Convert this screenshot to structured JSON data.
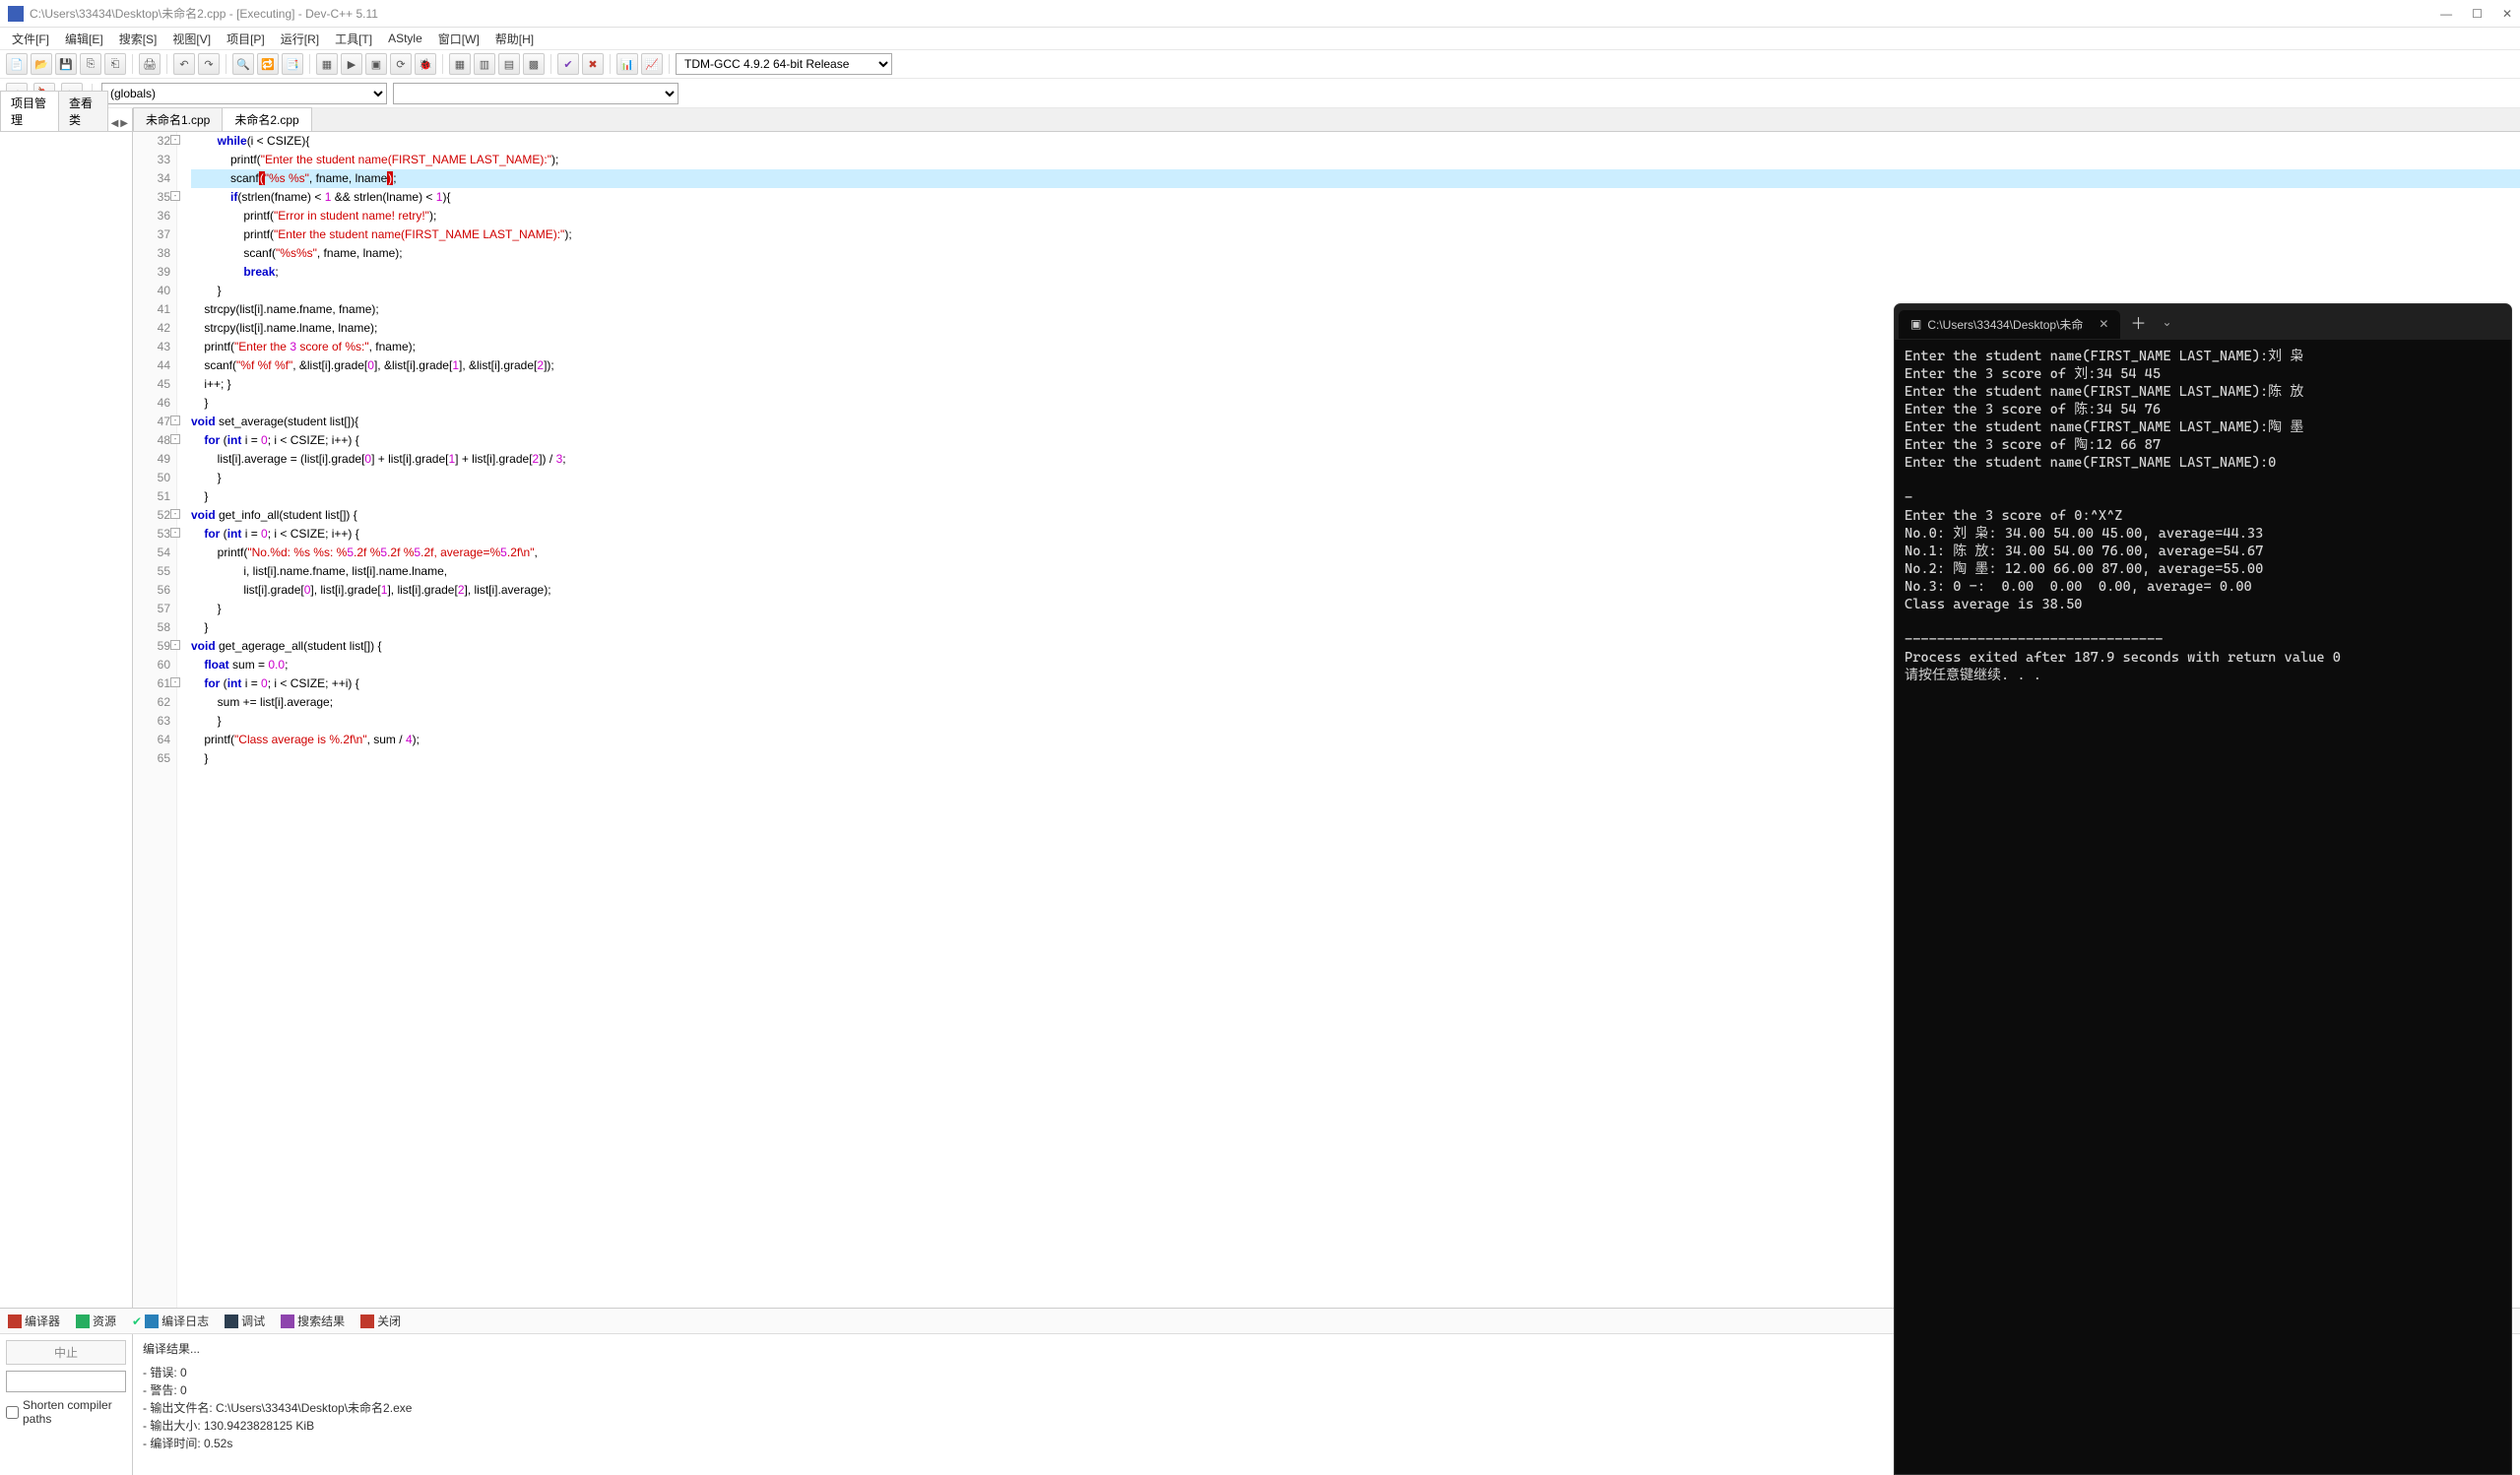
{
  "title": "C:\\Users\\33434\\Desktop\\未命名2.cpp - [Executing] - Dev-C++ 5.11",
  "menu": [
    "文件[F]",
    "编辑[E]",
    "搜索[S]",
    "视图[V]",
    "项目[P]",
    "运行[R]",
    "工具[T]",
    "AStyle",
    "窗口[W]",
    "帮助[H]"
  ],
  "compiler_combo": "TDM-GCC 4.9.2 64-bit Release",
  "globals": "(globals)",
  "left_tabs": [
    "项目管理",
    "查看类"
  ],
  "file_tabs": [
    "未命名1.cpp",
    "未命名2.cpp"
  ],
  "active_file_tab": 1,
  "code_start_line": 32,
  "highlight_line": 34,
  "fold_lines": [
    32,
    35,
    47,
    48,
    52,
    53,
    59,
    61
  ],
  "code_lines": [
    "        while(i < CSIZE){",
    "            printf(\"Enter the student name(FIRST_NAME LAST_NAME):\");",
    "            scanf(\"%s %s\", fname, lname);",
    "            if(strlen(fname) < 1 && strlen(lname) < 1){",
    "                printf(\"Error in student name! retry!\");",
    "                printf(\"Enter the student name(FIRST_NAME LAST_NAME):\");",
    "                scanf(\"%s%s\", fname, lname);",
    "                break;",
    "        }",
    "    strcpy(list[i].name.fname, fname);",
    "    strcpy(list[i].name.lname, lname);",
    "    printf(\"Enter the 3 score of %s:\", fname);",
    "    scanf(\"%f %f %f\", &list[i].grade[0], &list[i].grade[1], &list[i].grade[2]);",
    "    i++; }",
    "    }",
    "void set_average(student list[]){",
    "    for (int i = 0; i < CSIZE; i++) {",
    "        list[i].average = (list[i].grade[0] + list[i].grade[1] + list[i].grade[2]) / 3;",
    "        }",
    "    }",
    "void get_info_all(student list[]) {",
    "    for (int i = 0; i < CSIZE; i++) {",
    "        printf(\"No.%d: %s %s: %5.2f %5.2f %5.2f, average=%5.2f\\n\",",
    "                i, list[i].name.fname, list[i].name.lname,",
    "                list[i].grade[0], list[i].grade[1], list[i].grade[2], list[i].average);",
    "        }",
    "    }",
    "void get_agerage_all(student list[]) {",
    "    float sum = 0.0;",
    "    for (int i = 0; i < CSIZE; ++i) {",
    "        sum += list[i].average;",
    "        }",
    "    printf(\"Class average is %.2f\\n\", sum / 4);",
    "    }"
  ],
  "bottom_tabs": [
    {
      "icon": "#c0392b",
      "label": "编译器"
    },
    {
      "icon": "#27ae60",
      "label": "资源"
    },
    {
      "icon": "#2980b9",
      "label": "编译日志"
    },
    {
      "icon": "#2c3e50",
      "label": "调试"
    },
    {
      "icon": "#8e44ad",
      "label": "搜索结果"
    },
    {
      "icon": "#c0392b",
      "label": "关闭"
    }
  ],
  "bottom_left": {
    "abort": "中止",
    "shorten": "Shorten compiler paths"
  },
  "compile_result": {
    "header": "编译结果...",
    "lines": [
      "- 错误: 0",
      "- 警告: 0",
      "- 输出文件名: C:\\Users\\33434\\Desktop\\未命名2.exe",
      "- 输出大小: 130.9423828125 KiB",
      "- 编译时间: 0.52s"
    ]
  },
  "terminal": {
    "tab_title": "C:\\Users\\33434\\Desktop\\未命",
    "output": "Enter the student name(FIRST_NAME LAST_NAME):刘 枭\nEnter the 3 score of 刘:34 54 45\nEnter the student name(FIRST_NAME LAST_NAME):陈 放\nEnter the 3 score of 陈:34 54 76\nEnter the student name(FIRST_NAME LAST_NAME):陶 墨\nEnter the 3 score of 陶:12 66 87\nEnter the student name(FIRST_NAME LAST_NAME):0\n\n-\nEnter the 3 score of 0:^X^Z\nNo.0: 刘 枭: 34.00 54.00 45.00, average=44.33\nNo.1: 陈 放: 34.00 54.00 76.00, average=54.67\nNo.2: 陶 墨: 12.00 66.00 87.00, average=55.00\nNo.3: 0 -:  0.00  0.00  0.00, average= 0.00\nClass average is 38.50\n\n--------------------------------\nProcess exited after 187.9 seconds with return value 0\n请按任意键继续. . . "
  }
}
